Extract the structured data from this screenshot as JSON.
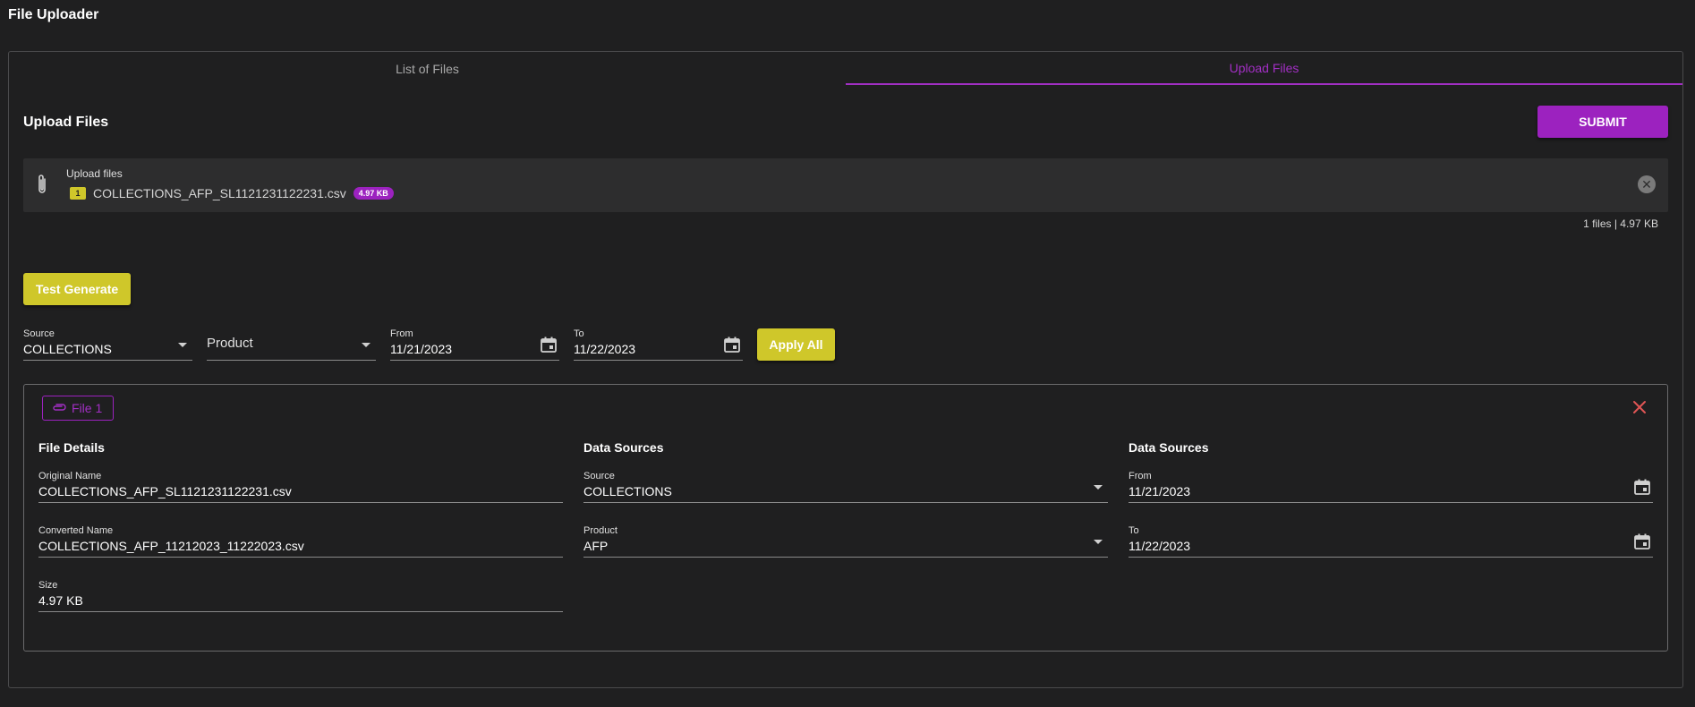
{
  "app": {
    "title": "File Uploader"
  },
  "tabs": [
    {
      "label": "List of Files",
      "active": false
    },
    {
      "label": "Upload Files",
      "active": true
    }
  ],
  "upload": {
    "title": "Upload Files",
    "submit_label": "SUBMIT",
    "dropzone": {
      "label": "Upload files",
      "count": "1",
      "file_name": "COLLECTIONS_AFP_SL1121231122231.csv",
      "file_size": "4.97 KB"
    },
    "summary": "1 files | 4.97 KB"
  },
  "test_generate_label": "Test Generate",
  "filters": {
    "source": {
      "label": "Source",
      "value": "COLLECTIONS"
    },
    "product": {
      "placeholder": "Product"
    },
    "from": {
      "label": "From",
      "value": "11/21/2023"
    },
    "to": {
      "label": "To",
      "value": "11/22/2023"
    },
    "apply_label": "Apply All"
  },
  "file_card": {
    "chip_label": "File 1",
    "columns": {
      "details_title": "File Details",
      "sources_title_1": "Data Sources",
      "sources_title_2": "Data Sources"
    },
    "original_name": {
      "label": "Original Name",
      "value": "COLLECTIONS_AFP_SL1121231122231.csv"
    },
    "converted_name": {
      "label": "Converted Name",
      "value": "COLLECTIONS_AFP_11212023_11222023.csv"
    },
    "size": {
      "label": "Size",
      "value": "4.97 KB"
    },
    "source": {
      "label": "Source",
      "value": "COLLECTIONS"
    },
    "product": {
      "label": "Product",
      "value": "AFP"
    },
    "from": {
      "label": "From",
      "value": "11/21/2023"
    },
    "to": {
      "label": "To",
      "value": "11/22/2023"
    }
  },
  "colors": {
    "accent_purple": "#9c22bf",
    "accent_yellow": "#cfc72a",
    "background": "#1f1f20",
    "danger": "#e05555"
  },
  "icons": [
    "paperclip-icon",
    "close-circle-icon",
    "chevron-down-icon",
    "calendar-icon",
    "close-icon"
  ]
}
